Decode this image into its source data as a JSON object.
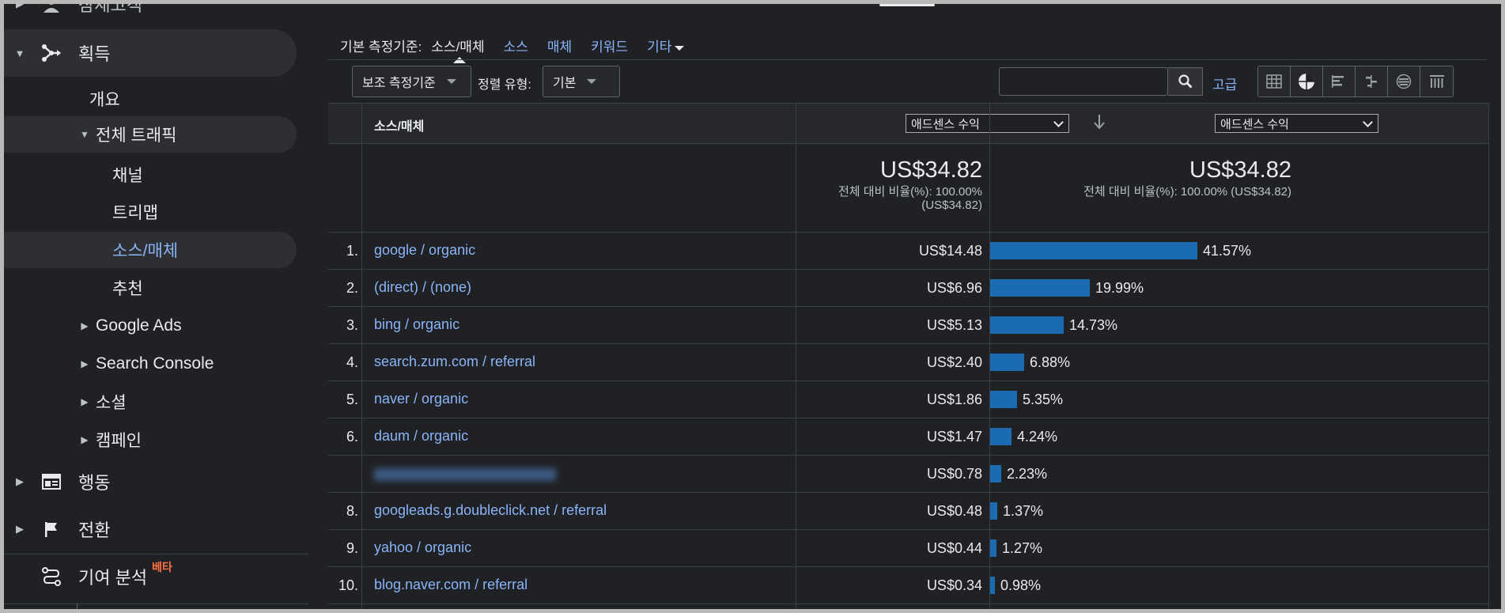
{
  "sidebar": {
    "top_partial": "잠재고객",
    "acquisition": "획득",
    "overview": "개요",
    "all_traffic": "전체 트래픽",
    "channels": "채널",
    "treemap": "트리맵",
    "source_medium": "소스/매체",
    "referrals": "추천",
    "google_ads": "Google Ads",
    "search_console": "Search Console",
    "social": "소셜",
    "campaigns": "캠페인",
    "behavior": "행동",
    "conversions": "전환",
    "attribution": "기여 분석",
    "beta": "베타"
  },
  "dimension_bar": {
    "label": "기본 측정기준:",
    "current": "소스/매체",
    "links": [
      "소스",
      "매체",
      "키워드"
    ],
    "more": "기타"
  },
  "controls": {
    "secondary_dimension": "보조 측정기준",
    "sort_type_label": "정렬 유형:",
    "sort_type_value": "기본",
    "search_value": "",
    "advanced": "고급",
    "view_icons": [
      "table-view-icon",
      "pie-view-icon",
      "performance-view-icon",
      "comparison-view-icon",
      "term-cloud-icon",
      "pivot-view-icon"
    ]
  },
  "table": {
    "dimension_header": "소스/매체",
    "metric1": "애드센스 수익",
    "metric2": "애드센스 수익",
    "total1": "US$34.82",
    "total1_sub_a": "전체 대비 비율(%): 100.00%",
    "total1_sub_b": "(US$34.82)",
    "total2": "US$34.82",
    "total2_sub": "전체 대비 비율(%): 100.00% (US$34.82)",
    "rows": [
      {
        "num": "1.",
        "source": "google / organic",
        "value": "US$14.48",
        "pct": "41.57%",
        "share": 41.57
      },
      {
        "num": "2.",
        "source": "(direct) / (none)",
        "value": "US$6.96",
        "pct": "19.99%",
        "share": 19.99
      },
      {
        "num": "3.",
        "source": "bing / organic",
        "value": "US$5.13",
        "pct": "14.73%",
        "share": 14.73
      },
      {
        "num": "4.",
        "source": "search.zum.com / referral",
        "value": "US$2.40",
        "pct": "6.88%",
        "share": 6.88
      },
      {
        "num": "5.",
        "source": "naver / organic",
        "value": "US$1.86",
        "pct": "5.35%",
        "share": 5.35
      },
      {
        "num": "6.",
        "source": "daum / organic",
        "value": "US$1.47",
        "pct": "4.24%",
        "share": 4.24
      },
      {
        "num": "",
        "source": "",
        "value": "US$0.78",
        "pct": "2.23%",
        "share": 2.23,
        "blurred": true
      },
      {
        "num": "8.",
        "source": "googleads.g.doubleclick.net / referral",
        "value": "US$0.48",
        "pct": "1.37%",
        "share": 1.37
      },
      {
        "num": "9.",
        "source": "yahoo / organic",
        "value": "US$0.44",
        "pct": "1.27%",
        "share": 1.27
      },
      {
        "num": "10.",
        "source": "blog.naver.com / referral",
        "value": "US$0.34",
        "pct": "0.98%",
        "share": 0.98
      }
    ]
  },
  "colors": {
    "background": "#202124",
    "link": "#8ab4f8",
    "bar": "#1a6bb0",
    "beta": "#ff7043"
  }
}
